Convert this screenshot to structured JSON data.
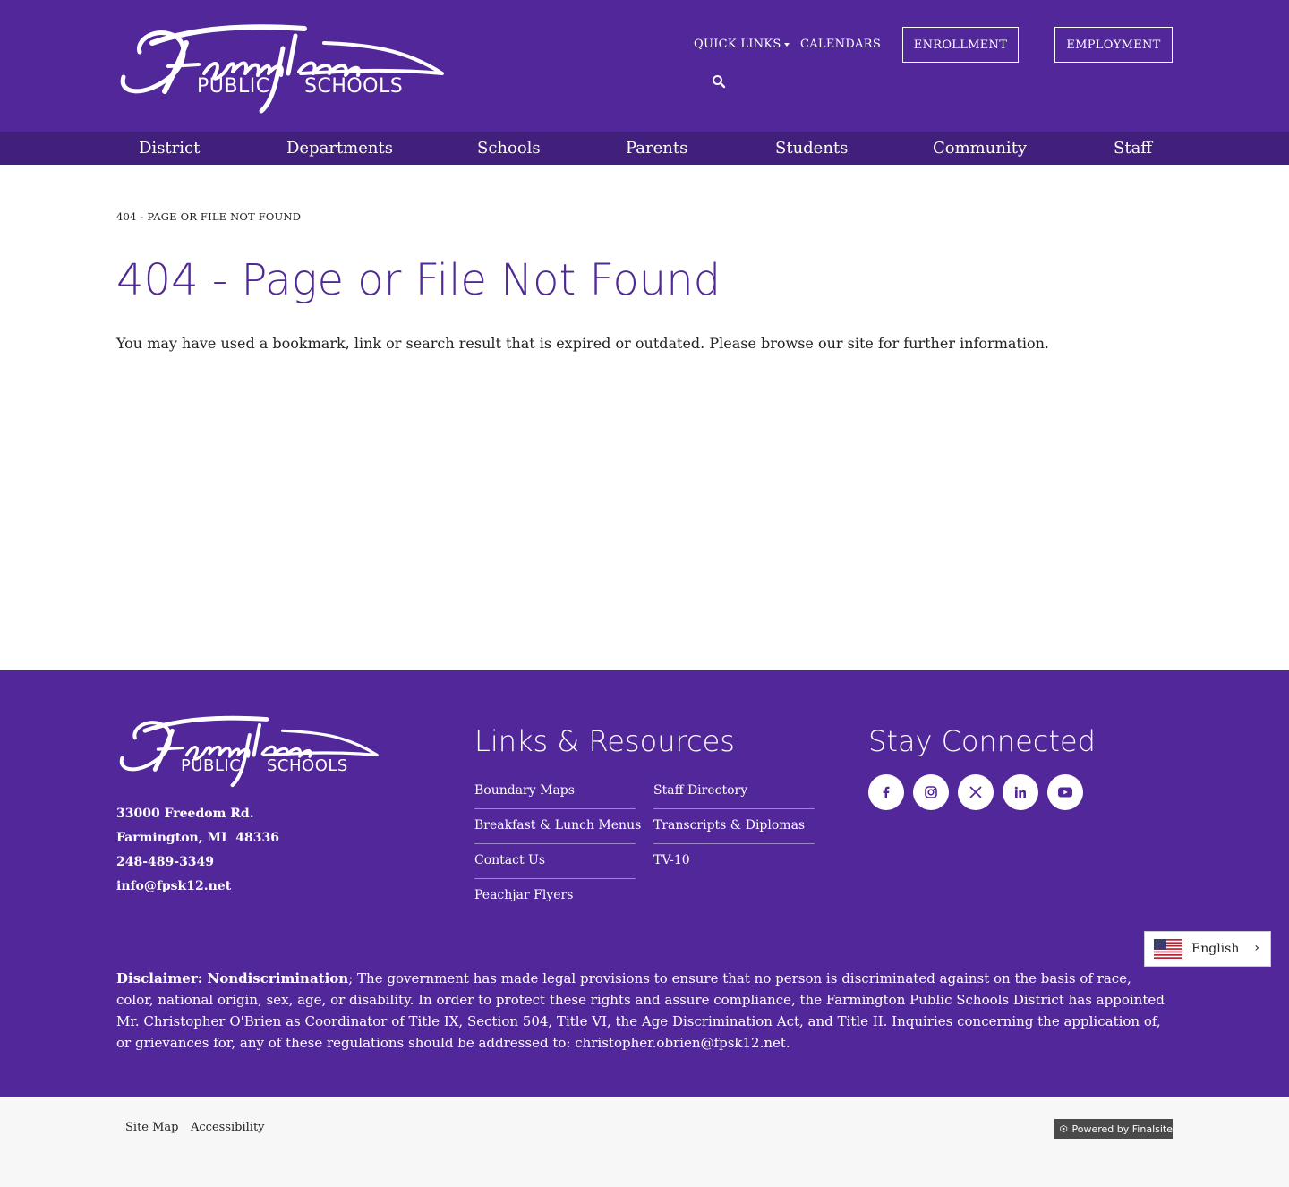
{
  "header": {
    "logo_script": "Farmington",
    "logo_sub_left": "PUBLIC",
    "logo_sub_right": "SCHOOLS",
    "quick_links": "QUICK LINKS",
    "calendars": "CALENDARS",
    "enrollment": "ENROLLMENT",
    "employment": "EMPLOYMENT",
    "search_icon": "search-icon"
  },
  "nav": {
    "items": [
      {
        "label": "District"
      },
      {
        "label": "Departments"
      },
      {
        "label": "Schools"
      },
      {
        "label": "Parents"
      },
      {
        "label": "Students"
      },
      {
        "label": "Community"
      },
      {
        "label": "Staff"
      }
    ]
  },
  "main": {
    "breadcrumb": "404 - PAGE OR FILE NOT FOUND",
    "title": "404 - Page or File Not Found",
    "body": "You may have used a bookmark, link or search result that is expired or outdated. Please browse our site for further information."
  },
  "footer": {
    "address_line1": "33000 Freedom Rd.",
    "address_line2": "Farmington, MI  48336",
    "phone": "248-489-3349",
    "email": "info@fpsk12.net",
    "links_heading": "Links & Resources",
    "links_col1": [
      "Boundary Maps",
      "Breakfast & Lunch Menus",
      "Contact Us",
      "Peachjar Flyers"
    ],
    "links_col2": [
      "Staff Directory",
      "Transcripts & Diplomas",
      "TV-10"
    ],
    "connect_heading": "Stay Connected",
    "social_icons": [
      "facebook-icon",
      "instagram-icon",
      "x-icon",
      "linkedin-icon",
      "youtube-icon"
    ],
    "disclaimer_bold": "Disclaimer: Nondiscrimination",
    "disclaimer_text": "; The government has made legal provisions to ensure that no person is discriminated against on the basis of race, color, national origin, sex, age, or disability. In order to protect these rights and assure compliance, the Farmington Public Schools District has appointed Mr. Christopher O'Brien as Coordinator of Title IX, Section 504, Title VI, the Age Discrimination Act, and Title II. Inquiries concerning the application of, or grievances for, any of these regulations should be addressed to: ",
    "disclaimer_email": "christopher.obrien@fpsk12.net",
    "disclaimer_end": ".",
    "language": "English"
  },
  "bottom": {
    "site_map": "Site Map",
    "accessibility": "Accessibility",
    "powered": "Powered by Finalsite"
  },
  "colors": {
    "brand_purple": "#51279a",
    "nav_purple": "#40207a",
    "title_purple": "#4f2a95"
  }
}
